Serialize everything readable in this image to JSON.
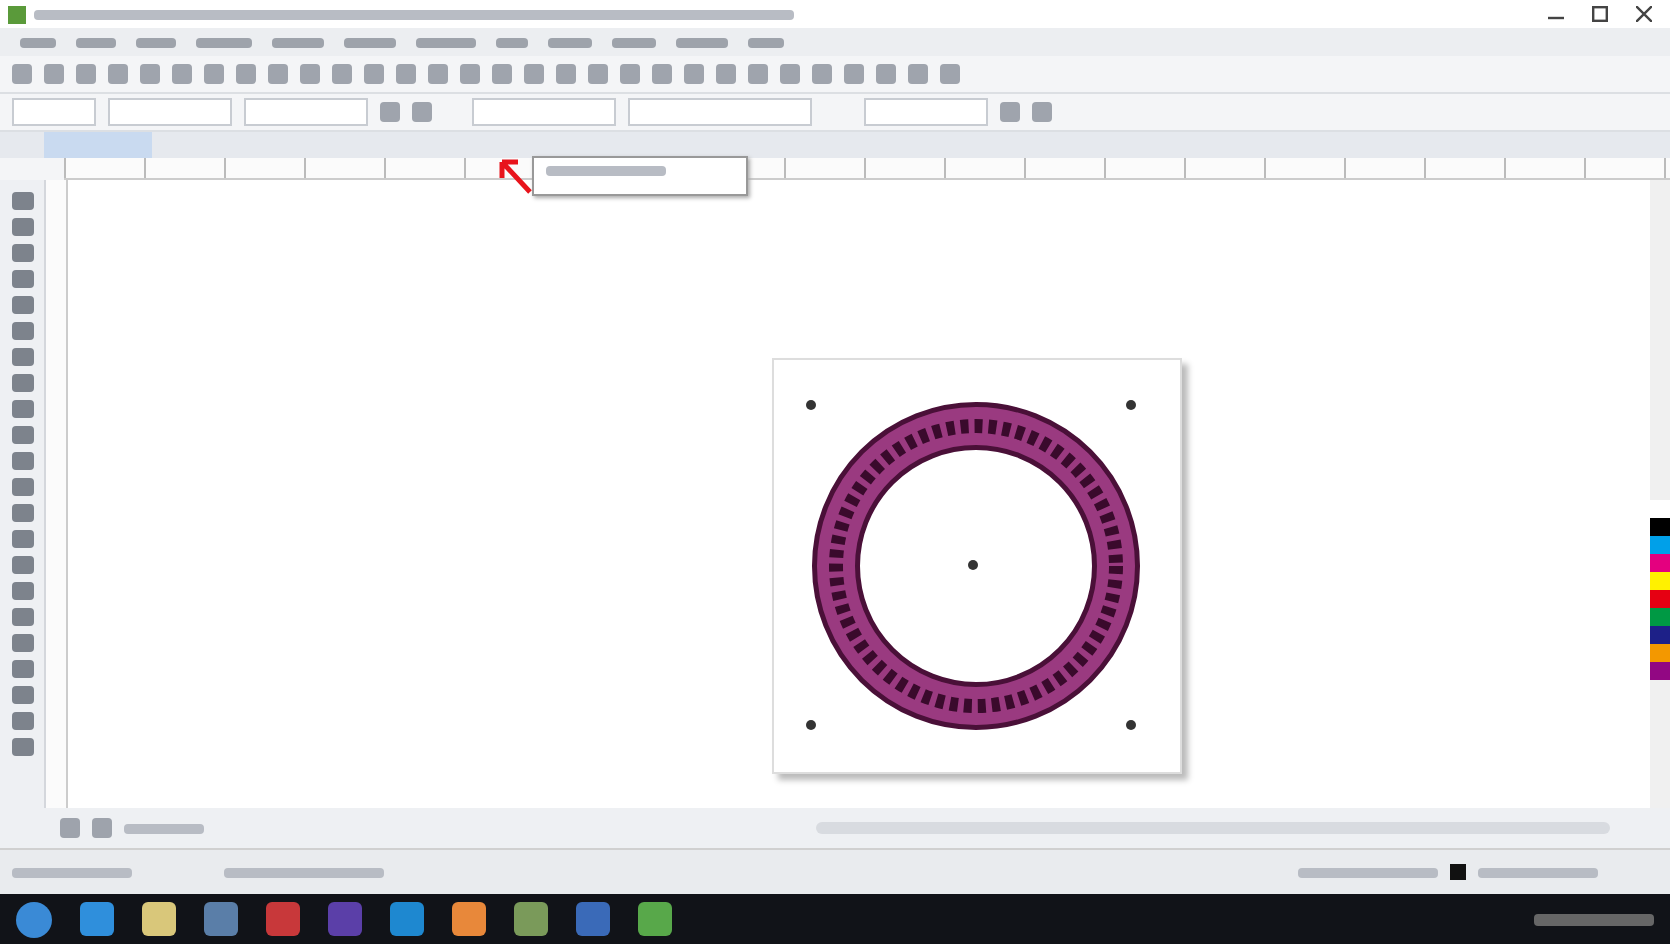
{
  "document_tabs": [
    {
      "selected": true
    }
  ],
  "palette": [
    {
      "color": "#ffffff"
    },
    {
      "color": "#000000"
    },
    {
      "color": "#00a0e9"
    },
    {
      "color": "#e4007f"
    },
    {
      "color": "#fff100"
    },
    {
      "color": "#e60012"
    },
    {
      "color": "#009944"
    },
    {
      "color": "#1d2088"
    },
    {
      "color": "#f39800"
    },
    {
      "color": "#920783"
    }
  ],
  "taskbar": {
    "apps": [
      {
        "color": "#2f8fdc"
      },
      {
        "color": "#d9c77a"
      },
      {
        "color": "#5a7ea8"
      },
      {
        "color": "#c8383a"
      },
      {
        "color": "#5b3fa8"
      },
      {
        "color": "#1e88d0"
      },
      {
        "color": "#e8883a"
      },
      {
        "color": "#7a9a5a"
      },
      {
        "color": "#3a6ab8"
      },
      {
        "color": "#58a84a"
      }
    ]
  }
}
